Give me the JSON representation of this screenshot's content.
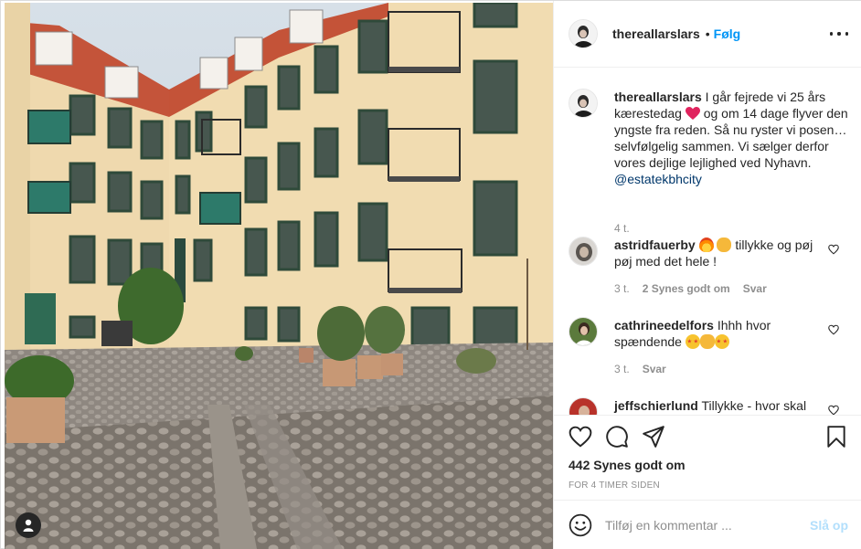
{
  "post": {
    "username": "thereallarslars",
    "separator": "•",
    "follow_label": "Følg",
    "more_icon": "more-horizontal-icon"
  },
  "caption": {
    "username": "thereallarslars",
    "text_part1": "I går fejrede vi 25 års kærestedag",
    "text_part2": "og om 14 dage flyver den yngste fra reden. Så nu ryster vi posen…selvfølgelig sammen. Vi sælger derfor vores dejlige lejlighed ved Nyhavn.",
    "mention": "@estatekbhcity",
    "time": "4 t."
  },
  "comments": [
    {
      "username": "astridfauerby",
      "text": "tillykke og pøj pøj med det hele !",
      "emojis": [
        "fire",
        "clap"
      ],
      "time": "3 t.",
      "likes": "2 Synes godt om",
      "reply": "Svar"
    },
    {
      "username": "cathrineedelfors",
      "text": "Ihhh hvor spændende",
      "emojis": [
        "star-struck",
        "thumbs-up",
        "star-struck"
      ],
      "time": "3 t.",
      "reply": "Svar"
    },
    {
      "username": "jeffschierlund",
      "text": "Tillykke - hvor skal"
    }
  ],
  "actions": {
    "like_icon": "heart-icon",
    "comment_icon": "comment-icon",
    "share_icon": "share-icon",
    "save_icon": "bookmark-icon"
  },
  "likes_count": "442 Synes godt om",
  "post_time": "FOR 4 TIMER SIDEN",
  "comment_box": {
    "placeholder": "Tilføj en kommentar ...",
    "post_label": "Slå op"
  },
  "colors": {
    "accent": "#0095f6",
    "mention": "#00376b",
    "heart": "#e0245e",
    "muted": "#8e8e8e",
    "post_disabled": "#b2dffc"
  }
}
